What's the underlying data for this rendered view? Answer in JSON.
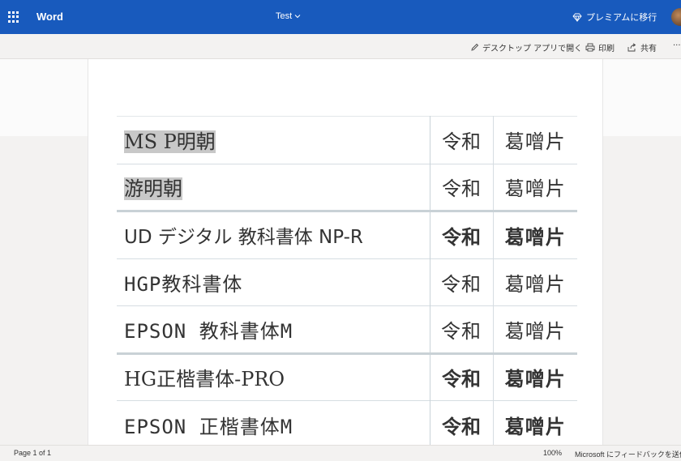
{
  "appbar": {
    "app_name": "Word",
    "doc_title": "Test",
    "premium_label": "プレミアムに移行"
  },
  "ribbon": {
    "open_desktop_label": "デスクトップ アプリで開く",
    "print_label": "印刷",
    "share_label": "共有",
    "more_label": "···"
  },
  "document": {
    "rows": [
      {
        "font_name": "MS P明朝",
        "reiwa": "令和",
        "kanji": "葛噌片",
        "highlighted": true
      },
      {
        "font_name": "游明朝",
        "reiwa": "令和",
        "kanji": "葛噌片",
        "highlighted": true
      },
      {
        "font_name": "UD デジタル 教科書体 NP-R",
        "reiwa": "令和",
        "kanji": "葛噌片",
        "highlighted": false
      },
      {
        "font_name": "HGP教科書体",
        "reiwa": "令和",
        "kanji": "葛噌片",
        "highlighted": false
      },
      {
        "font_name": "EPSON 教科書体M",
        "reiwa": "令和",
        "kanji": "葛噌片",
        "highlighted": false
      },
      {
        "font_name": "HG正楷書体-PRO",
        "reiwa": "令和",
        "kanji": "葛噌片",
        "highlighted": false
      },
      {
        "font_name": "EPSON 正楷書体M",
        "reiwa": "令和",
        "kanji": "葛噌片",
        "highlighted": false
      }
    ]
  },
  "statusbar": {
    "page_count": "Page 1 of 1",
    "zoom": "100%",
    "feedback": "Microsoft にフィードバックを送信"
  },
  "colors": {
    "brand": "#185abd",
    "highlight": "#c8c8c8"
  }
}
